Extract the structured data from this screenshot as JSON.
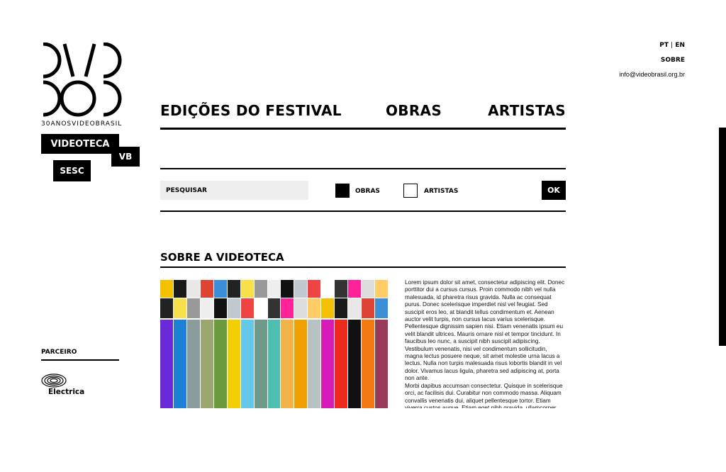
{
  "brand": {
    "logo_caption": "30ANOSVIDEOBRASIL",
    "videoteca": "VIDEOTECA",
    "vb": "VB",
    "sesc": "SESC"
  },
  "top_right": {
    "lang_pt": "PT",
    "lang_sep": "|",
    "lang_en": "EN",
    "sobre": "SOBRE",
    "email": "info@videobrasil.org.br"
  },
  "nav": {
    "edicoes": "EDIÇÕES DO FESTIVAL",
    "obras": "OBRAS",
    "artistas": "ARTISTAS"
  },
  "search": {
    "placeholder": "PESQUISAR",
    "opt_obras": "OBRAS",
    "opt_artistas": "ARTISTAS",
    "ok": "OK",
    "obras_checked": true,
    "artistas_checked": false
  },
  "about": {
    "title": "SOBRE A VIDEOTECA",
    "body": "Lorem ipsum dolor sit amet, consectetur adipiscing elit. Donec porttitor dui a cursus cursus. Proin commodo nibh vel nulla malesuada, id pharetra risus gravida. Nulla ac consequat purus. Donec scelerisque imperdiet nisl vel feugiat. Sed suscipit eros leo, at blandit tellus condimentum et. Aenean auctor velit turpis, non cursus lacus varius scelerisque. Pellentesque dignissim sapien nisi. Etiam venenatis ipsum eu velit blandit ultrices. Mauris ornare nisl et tempor tincidunt. In faucibus leo nunc, a suscipit nibh suscipit adipiscing. Vestibulum venenatis, nisi vel condimentum sollicitudin, magna lectus posuere neque, sit amet molestie urna lacus a lectus. Nulla non turpis malesuada risus lobortis blandit in vel dolor. Vivamus lacus ligula, pharetra sed adipiscing at, porta non ante.",
    "body2": "Morbi dapibus accumsan consectetur. Quisque in scelerisque orci, ac facilisis dui. Curabitur non commodo massa. Aliquam convallis venenatis dui, aliquet pellentesque tortor. Etiam viverra custos augue. Etiam eget nibh gravida, ullamcorper elit."
  },
  "color_strips": [
    "#6b2ad8",
    "#1e7fd6",
    "#8b9a9a",
    "#9aa870",
    "#6b9a3c",
    "#f2cf00",
    "#66c8e8",
    "#6f9a8a",
    "#4dbfb0",
    "#f2b24a",
    "#f0a000",
    "#b8c2c4",
    "#d81ab8",
    "#ee2a1e",
    "#111111",
    "#f27a10",
    "#9a3a5a"
  ],
  "partner": {
    "label": "PARCEIRO",
    "name": "Electrica"
  }
}
